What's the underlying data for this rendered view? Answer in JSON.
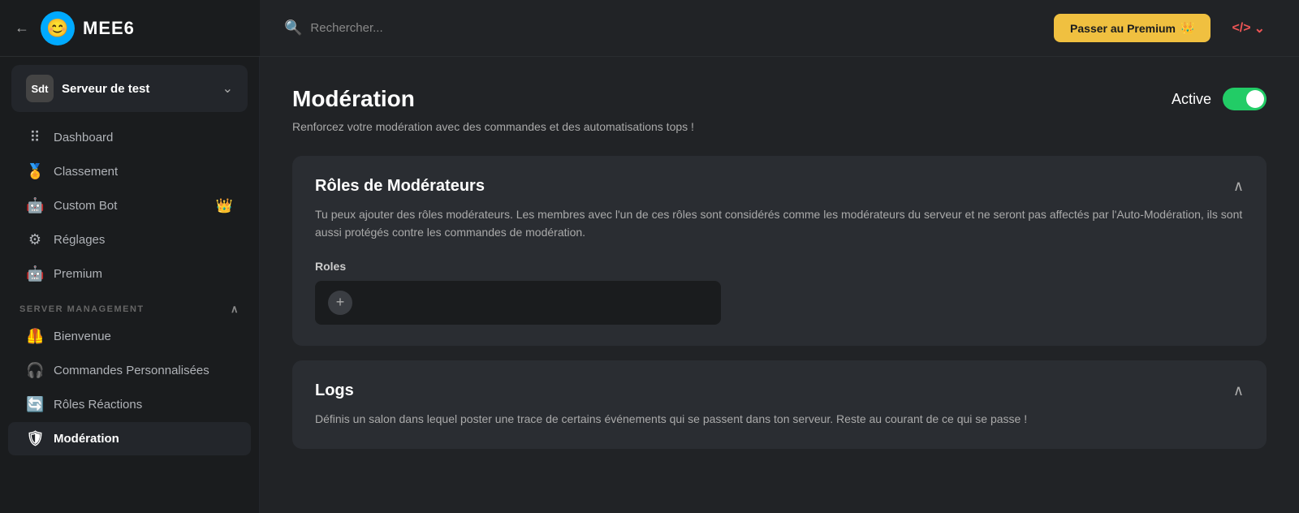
{
  "logo": {
    "text": "MEE6",
    "emoji": "😊"
  },
  "header": {
    "search_placeholder": "Rechercher...",
    "premium_btn": "Passer au Premium",
    "premium_icon": "👑",
    "code_btn": "</>",
    "chevron": "⌄"
  },
  "server": {
    "name": "Serveur de test",
    "initials": "Sdt",
    "chevron": "⌄"
  },
  "nav": {
    "items": [
      {
        "id": "dashboard",
        "label": "Dashboard",
        "icon": "⠿",
        "active": false
      },
      {
        "id": "classement",
        "label": "Classement",
        "icon": "🏅",
        "active": false
      },
      {
        "id": "custom-bot",
        "label": "Custom Bot",
        "icon": "🤖",
        "active": false,
        "badge": "👑"
      },
      {
        "id": "reglages",
        "label": "Réglages",
        "icon": "⚙",
        "active": false
      },
      {
        "id": "premium",
        "label": "Premium",
        "icon": "🤖",
        "active": false
      }
    ],
    "section_label": "SERVER MANAGEMENT",
    "section_items": [
      {
        "id": "bienvenue",
        "label": "Bienvenue",
        "icon": "🦺",
        "active": false
      },
      {
        "id": "commandes-personnalisees",
        "label": "Commandes Personnalisées",
        "icon": "🎧",
        "active": false
      },
      {
        "id": "roles-reactions",
        "label": "Rôles Réactions",
        "icon": "🔄",
        "active": false
      },
      {
        "id": "moderation",
        "label": "Modération",
        "icon": "🛡",
        "active": true
      }
    ]
  },
  "page": {
    "title": "Modération",
    "subtitle": "Renforcez votre modération avec des commandes et des automatisations tops !",
    "active_label": "Active",
    "toggle_on": true
  },
  "cards": [
    {
      "id": "roles-moderateurs",
      "title": "Rôles de Modérateurs",
      "description": "Tu peux ajouter des rôles modérateurs. Les membres avec l'un de ces rôles sont considérés comme les modérateurs du serveur et ne seront pas affectés par l'Auto-Modération, ils sont aussi protégés contre les commandes de modération.",
      "roles_label": "Roles",
      "add_btn": "+"
    },
    {
      "id": "logs",
      "title": "Logs",
      "description": "Définis un salon dans lequel poster une trace de certains événements qui se passent dans ton serveur. Reste au courant de ce qui se passe !"
    }
  ],
  "icons": {
    "back": "←",
    "chevron_down": "∨",
    "chevron_up": "∧",
    "search": "🔍",
    "collapse": "∧"
  }
}
